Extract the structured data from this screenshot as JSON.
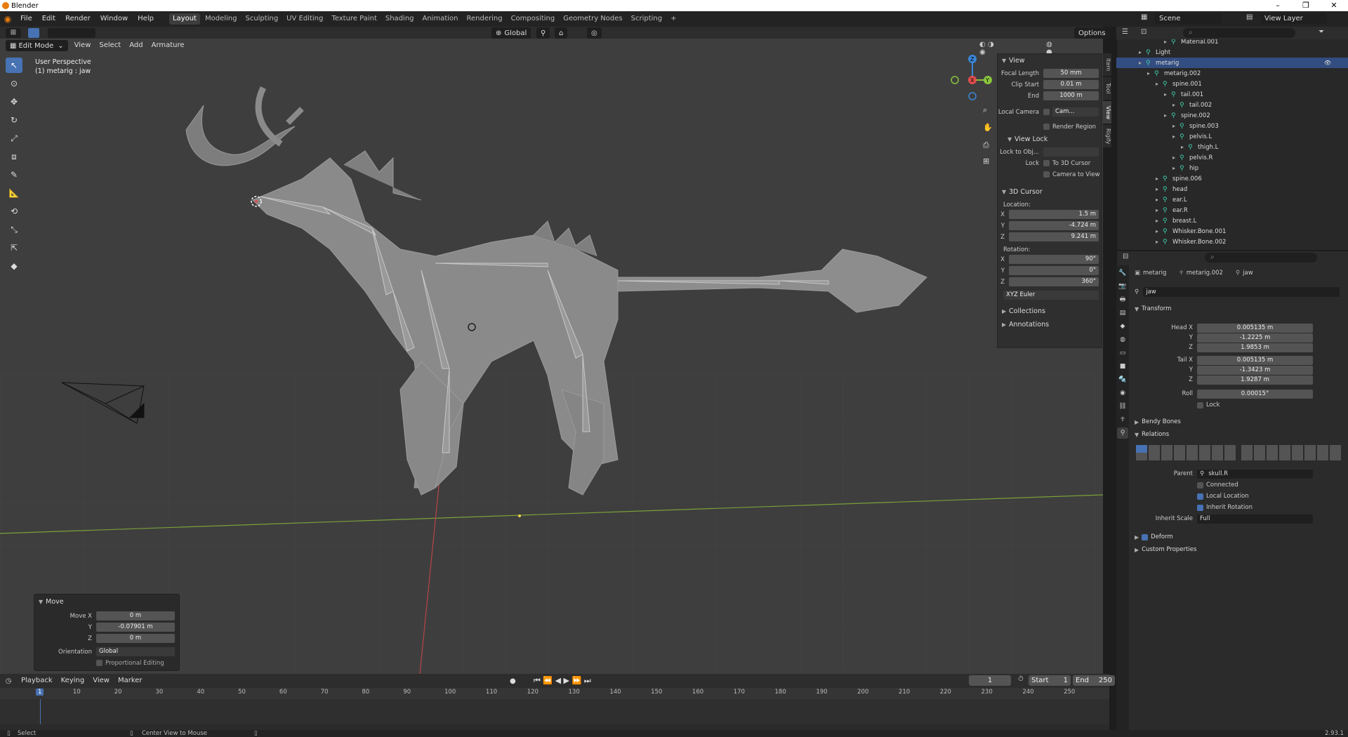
{
  "app": {
    "title": "Blender",
    "version": "2.93.1"
  },
  "menu": [
    "File",
    "Edit",
    "Render",
    "Window",
    "Help"
  ],
  "workspaces": [
    "Layout",
    "Modeling",
    "Sculpting",
    "UV Editing",
    "Texture Paint",
    "Shading",
    "Animation",
    "Rendering",
    "Compositing",
    "Geometry Nodes",
    "Scripting"
  ],
  "scene": {
    "name": "Scene",
    "view_layer": "View Layer"
  },
  "viewport": {
    "mode": "Edit Mode",
    "menus": [
      "View",
      "Select",
      "Add",
      "Armature"
    ],
    "transform_orientation": "Global",
    "options_label": "Options",
    "perspective": "User Perspective",
    "object_label": "(1) metarig : jaw"
  },
  "npanel": {
    "tabs": [
      "Item",
      "Tool",
      "View",
      "Rigify"
    ],
    "view_section": "View",
    "focal_length_label": "Focal Length",
    "focal_length": "50 mm",
    "clip_start_label": "Clip Start",
    "clip_start": "0.01 m",
    "clip_end_label": "End",
    "clip_end": "1000 m",
    "local_camera_label": "Local Camera",
    "camera_placeholder": "Cam...",
    "render_region": "Render Region",
    "view_lock_section": "View Lock",
    "lock_to_object_label": "Lock to Obj...",
    "lock_label": "Lock",
    "to_3d_cursor": "To 3D Cursor",
    "camera_to_view": "Camera to View",
    "cursor_section": "3D Cursor",
    "location_label": "Location:",
    "loc_x": "1.5 m",
    "loc_y": "-4.724 m",
    "loc_z": "9.241 m",
    "rotation_label": "Rotation:",
    "rot_x": "90°",
    "rot_y": "0°",
    "rot_z": "360°",
    "rotation_mode": "XYZ Euler",
    "collections": "Collections",
    "annotations": "Annotations"
  },
  "move_panel": {
    "title": "Move",
    "move_x_label": "Move X",
    "move_x": "0 m",
    "y_label": "Y",
    "move_y": "-0.07901 m",
    "z_label": "Z",
    "move_z": "0 m",
    "orientation_label": "Orientation",
    "orientation": "Global",
    "proportional": "Proportional Editing"
  },
  "timeline": {
    "menus": [
      "Playback",
      "Keying",
      "View",
      "Marker"
    ],
    "current_frame": "1",
    "start_label": "Start",
    "start": "1",
    "end_label": "End",
    "end": "250",
    "ruler": [
      "1",
      "10",
      "20",
      "30",
      "40",
      "50",
      "60",
      "70",
      "80",
      "90",
      "100",
      "110",
      "120",
      "130",
      "140",
      "150",
      "160",
      "170",
      "180",
      "190",
      "200",
      "210",
      "220",
      "230",
      "240",
      "250"
    ]
  },
  "status": {
    "select": "Select",
    "center_view": "Center View to Mouse",
    "version": "2.93.1"
  },
  "outliner": {
    "rows": [
      {
        "label": "Material.001",
        "indent": 5
      },
      {
        "label": "Light",
        "indent": 2
      },
      {
        "label": "metarig",
        "indent": 2,
        "selected": true
      },
      {
        "label": "metarig.002",
        "indent": 3
      },
      {
        "label": "spine.001",
        "indent": 4
      },
      {
        "label": "tail.001",
        "indent": 5
      },
      {
        "label": "tail.002",
        "indent": 6
      },
      {
        "label": "spine.002",
        "indent": 5
      },
      {
        "label": "spine.003",
        "indent": 6
      },
      {
        "label": "pelvis.L",
        "indent": 6
      },
      {
        "label": "thigh.L",
        "indent": 7
      },
      {
        "label": "pelvis.R",
        "indent": 6
      },
      {
        "label": "hip",
        "indent": 6
      },
      {
        "label": "spine.006",
        "indent": 4
      },
      {
        "label": "head",
        "indent": 4
      },
      {
        "label": "ear.L",
        "indent": 4
      },
      {
        "label": "ear.R",
        "indent": 4
      },
      {
        "label": "breast.L",
        "indent": 4
      },
      {
        "label": "Whisker.Bone.001",
        "indent": 4
      },
      {
        "label": "Whisker.Bone.002",
        "indent": 4
      }
    ]
  },
  "properties": {
    "breadcrumb": [
      "metarig",
      "metarig.002",
      "jaw"
    ],
    "bone_name": "jaw",
    "transform_section": "Transform",
    "head_x_label": "Head X",
    "head_x": "0.005135 m",
    "head_y": "-1.2225 m",
    "head_z": "1.9853 m",
    "tail_x_label": "Tail X",
    "tail_x": "0.005135 m",
    "tail_y": "-1.3423 m",
    "tail_z": "1.9287 m",
    "roll_label": "Roll",
    "roll": "0.00015°",
    "lock_label": "Lock",
    "bendy_bones": "Bendy Bones",
    "relations": "Relations",
    "parent_label": "Parent",
    "parent": "skull.R",
    "connected": "Connected",
    "local_location": "Local Location",
    "inherit_rotation": "Inherit Rotation",
    "inherit_scale_label": "Inherit Scale",
    "inherit_scale": "Full",
    "deform": "Deform",
    "custom_properties": "Custom Properties"
  },
  "colors": {
    "accent": "#4772b3",
    "bone": "#3fd3b0",
    "axis_x": "#e04e4e",
    "axis_y": "#8ac33d",
    "axis_z": "#3a86d6"
  }
}
